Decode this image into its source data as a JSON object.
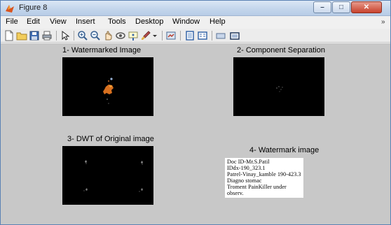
{
  "window": {
    "title": "Figure 8",
    "controls": {
      "minimize": "–",
      "maximize": "□",
      "close": "✕"
    }
  },
  "menu": [
    "File",
    "Edit",
    "View",
    "Insert",
    "Tools",
    "Desktop",
    "Window",
    "Help"
  ],
  "menu_overflow": "»",
  "toolbar": {
    "icons": [
      "new-figure-icon",
      "open-file-icon",
      "save-icon",
      "print-icon",
      "pointer-icon",
      "zoom-in-icon",
      "zoom-out-icon",
      "pan-icon",
      "rotate-3d-icon",
      "data-cursor-icon",
      "brush-icon",
      "link-plot-icon",
      "colorbar-icon",
      "legend-icon",
      "hide-plot-tools-icon",
      "show-plot-tools-icon"
    ]
  },
  "plots": {
    "p1": {
      "title": "1- Watermarked Image"
    },
    "p2": {
      "title": "2- Component Separation"
    },
    "p3": {
      "title": "3- DWT of Original image"
    },
    "p4": {
      "title": "4- Watermark image"
    }
  },
  "watermark_text": [
    "Doc ID-Mr.S.Patil",
    "IDdx-190_323.1",
    "Patrel-Vinay_kamble 190-423.3",
    "Diagno  stomac",
    "Troment PainKiller under",
    "observ."
  ],
  "colors": {
    "titlebar": "#c4d6ec",
    "figure_background": "#c8c8c8",
    "axes_background": "#000000",
    "highlight_orange": "#e07020"
  }
}
